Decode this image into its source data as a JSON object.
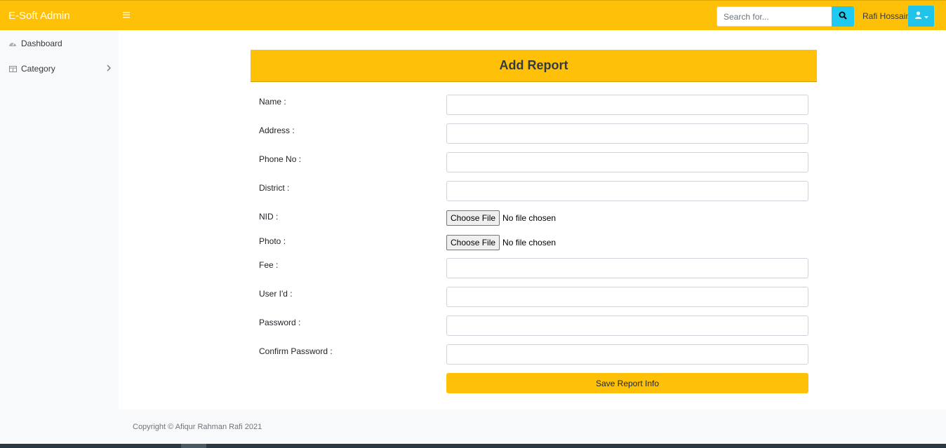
{
  "topbar": {
    "brand": "E-Soft Admin",
    "toggle_icon": "hamburger-icon",
    "search_placeholder": "Search for...",
    "search_icon": "search-icon",
    "user_name": "Rafi Hossain",
    "user_icon": "user-icon",
    "accent_color": "#ffc107"
  },
  "sidebar": {
    "items": [
      {
        "label": "Dashboard",
        "icon": "dashboard-icon"
      },
      {
        "label": "Category",
        "icon": "table-icon"
      }
    ]
  },
  "form": {
    "title": "Add Report",
    "fields": [
      {
        "label": "Name :"
      },
      {
        "label": "Address :"
      },
      {
        "label": "Phone No :"
      },
      {
        "label": "District :"
      },
      {
        "label": "NID :"
      },
      {
        "label": "Photo :"
      },
      {
        "label": "Fee :"
      },
      {
        "label": "User I'd :"
      },
      {
        "label": "Password :"
      },
      {
        "label": "Confirm Password :"
      }
    ],
    "file_button": "Choose File",
    "file_status": "No file chosen",
    "submit": "Save Report Info"
  },
  "footer": {
    "copyright": "Copyright © Afiqur Rahman Rafi 2021"
  }
}
